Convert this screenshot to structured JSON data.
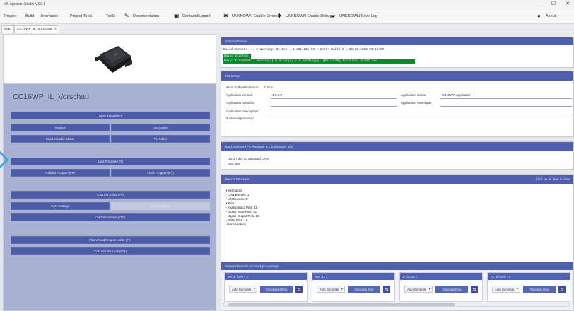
{
  "window": {
    "title": "MB Agnostic Studio V3.0.1",
    "controls": [
      "–",
      "☐",
      "✕"
    ]
  },
  "menu": {
    "project": "Project",
    "build": "Build",
    "interfaces": "Interfaces",
    "project_tools": "Project Tools",
    "tools": "Tools",
    "documentation": "Documentation",
    "contact_support": "Contact/Support",
    "unknown_enable_errors": "UNKNOWN Enable Errors",
    "unknown_enable_debug": "UNKNOWN Enable Debug",
    "unknown_save_log": "UNKNOWN Save Log",
    "about": "About"
  },
  "tabs": [
    {
      "label": "Start"
    },
    {
      "label": "CC16WP_IL_Vorschau",
      "close": "✕"
    }
  ],
  "left": {
    "device_title": "CC16WP_IL_Vorschau",
    "buttons": {
      "open_explorer": "Open in Explorer",
      "settings": "Settings",
      "information": "Information",
      "read_variable_status": "Read Variable Status",
      "pin_editor": "Pin Editor",
      "build_program": "Build Program (F5)",
      "rebuild_program": "Rebuild Program (F6)",
      "flash_program": "Flash Program (F7)",
      "can_db_editor": "CAN DB Editor (F8)",
      "can_settings": "CAN Settings",
      "can_analyzer_disabled": "CAN Analyzer",
      "can_simulation": "CAN Simulation (F10)",
      "flash_programming_mode": "Flash/Read Program while (F9)",
      "can_monitor": "CAN Monitor Lock (F11)"
    }
  },
  "right": {
    "log": {
      "header": "Output Window",
      "line1": "Build Output: ... 0  Warning:   System = 1.201.222.89  |  Conf: Build 0 | 12.01.2023  09:10:59",
      "line2": "Build started",
      "line3": "Build finished: 1 module(s) 0 error(s) / 0 warning(s)  [Build OK]  Duration: 0.012 sec"
    },
    "properties": {
      "header": "Properties",
      "basic_software_label": "Basic Software Version:",
      "basic_software_value": "3.10.0",
      "app_version_label": "Application Version:",
      "app_version_value": "1.0.0.0",
      "app_name_label": "Application Name:",
      "app_name_value": "CC16WP Application",
      "app_identifier_label": "Application Identifier:",
      "app_developer_label": "Application Developer:",
      "app_description_label": "Application Description:",
      "runtime_label": "Runtime Application:"
    },
    "hardware": {
      "header": "Hard Settings (Pin Package & Lib Settings) info",
      "line1": "1316 (M2) 2c  Standard CAN",
      "line2": "125 kBit"
    },
    "tree": {
      "header": "Project Structure",
      "hint": "Click on an item to view",
      "items": [
        "▾ Interfaces",
        "   • CAN Busses: 1",
        "   • LIN Busses: 1",
        "▾ Pins",
        "   • Analog Input Pins: 16",
        "   • Digital Input Pins: 31",
        "   • Digital Output Pins: 16",
        "   • PWM Pins: 16",
        "   User Variables"
      ]
    },
    "channels": {
      "header": "Output channels (sensor) pin settings",
      "cards": [
        {
          "title": "MV_B (1x9) = 1",
          "dropdown": "Auto Generate",
          "button": "Choose pin Row"
        },
        {
          "title": "MV_B1 1",
          "dropdown": "Auto Generate",
          "button": "Generate Row"
        },
        {
          "title": "B_SENS 1",
          "dropdown": "Auto Generate",
          "button": "Generate Row"
        },
        {
          "title": "PL_B (1x9) = 1",
          "dropdown": "Auto Generate",
          "button": "Generate Row"
        }
      ],
      "card_icon": "⇆"
    }
  },
  "colors": {
    "accent": "#4b5ba6",
    "panel": "#a9b1d3",
    "success": "#0c8a2f"
  },
  "icons": {
    "documentation": "book-icon",
    "contact": "monitor-icon",
    "errors": "gear-icon",
    "debug": "bug-icon",
    "save_log": "folder-icon",
    "about": "info-icon"
  }
}
